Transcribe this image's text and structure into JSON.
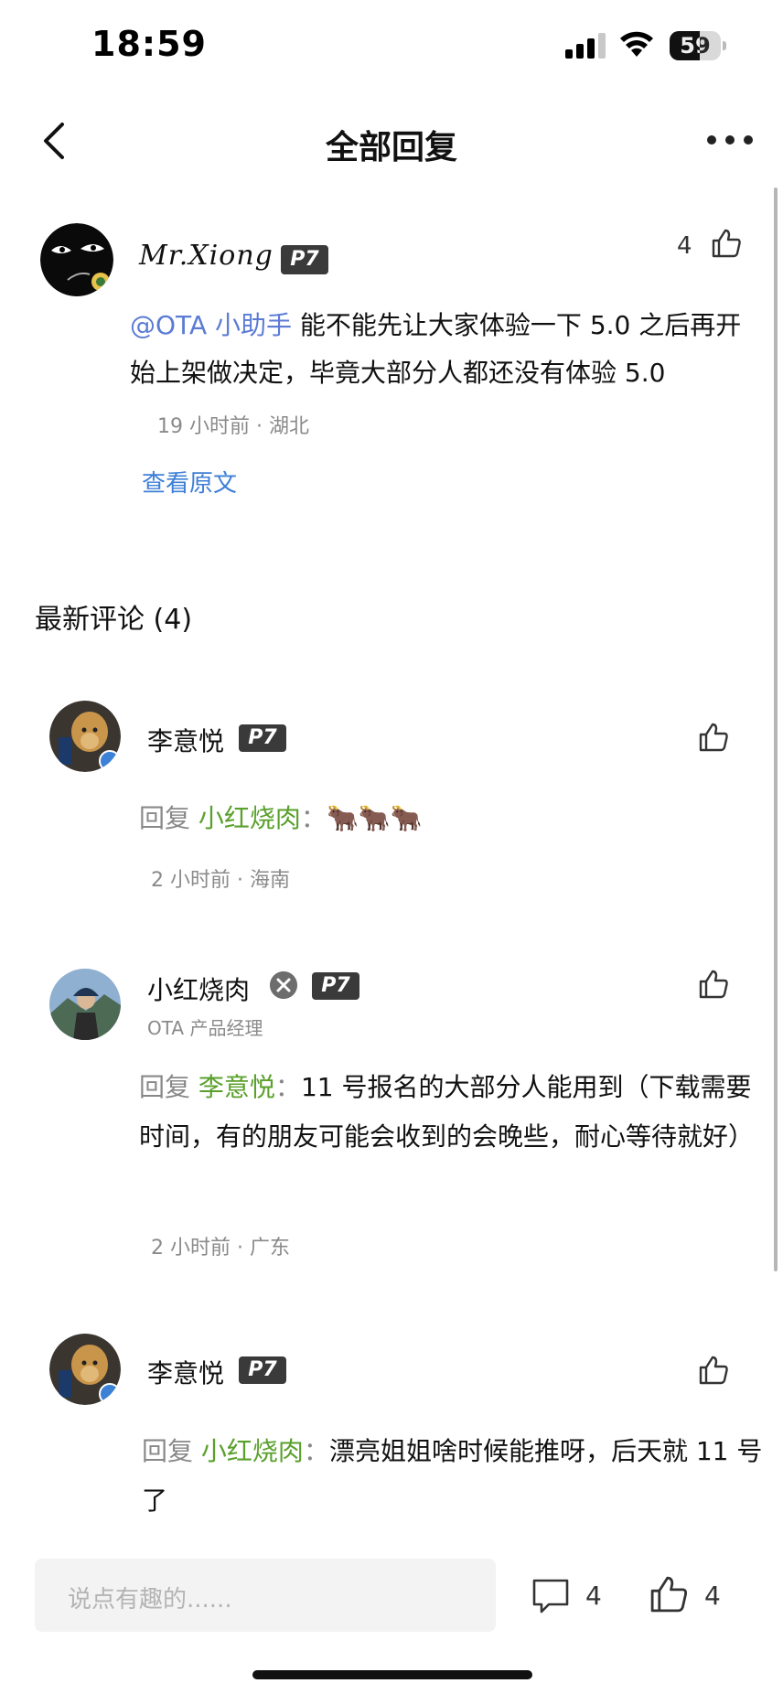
{
  "status_bar": {
    "time": "18:59",
    "battery": "59",
    "battery_level": 0.59
  },
  "nav": {
    "title": "全部回复"
  },
  "post": {
    "username": "Mr.Xiong",
    "level_badge": "P7",
    "like_count": "4",
    "mention": "@OTA 小助手",
    "text": " 能不能先让大家体验一下 5.0 之后再开始上架做决定，毕竟大部分人都还没有体验 5.0",
    "meta": "19 小时前 · 湖北",
    "view_original": "查看原文"
  },
  "comments_section": {
    "title": "最新评论 (4)"
  },
  "comments": [
    {
      "name": "李意悦",
      "badge": "P7",
      "reply_prefix": "回复 ",
      "reply_to": "小红烧肉",
      "separator": "：",
      "text": "🐂🐂🐂",
      "meta": "2 小时前 · 海南"
    },
    {
      "name": "小红烧肉",
      "badge": "P7",
      "subtitle": "OTA 产品经理",
      "reply_prefix": "回复 ",
      "reply_to": "李意悦",
      "separator": "：",
      "text": "11 号报名的大部分人能用到（下载需要时间，有的朋友可能会收到的会晚些，耐心等待就好）",
      "meta": "2 小时前 · 广东"
    },
    {
      "name": "李意悦",
      "badge": "P7",
      "reply_prefix": "回复 ",
      "reply_to": "小红烧肉",
      "separator": "：",
      "text": "漂亮姐姐啥时候能推呀，后天就 11 号了"
    }
  ],
  "bottom_bar": {
    "input_placeholder": "说点有趣的......",
    "comment_count": "4",
    "like_count": "4"
  },
  "icons": [
    "back-icon",
    "more-icon",
    "thumbs-up-icon",
    "comment-icon",
    "signal-icon",
    "wifi-icon",
    "battery-icon",
    "verified-icon"
  ]
}
